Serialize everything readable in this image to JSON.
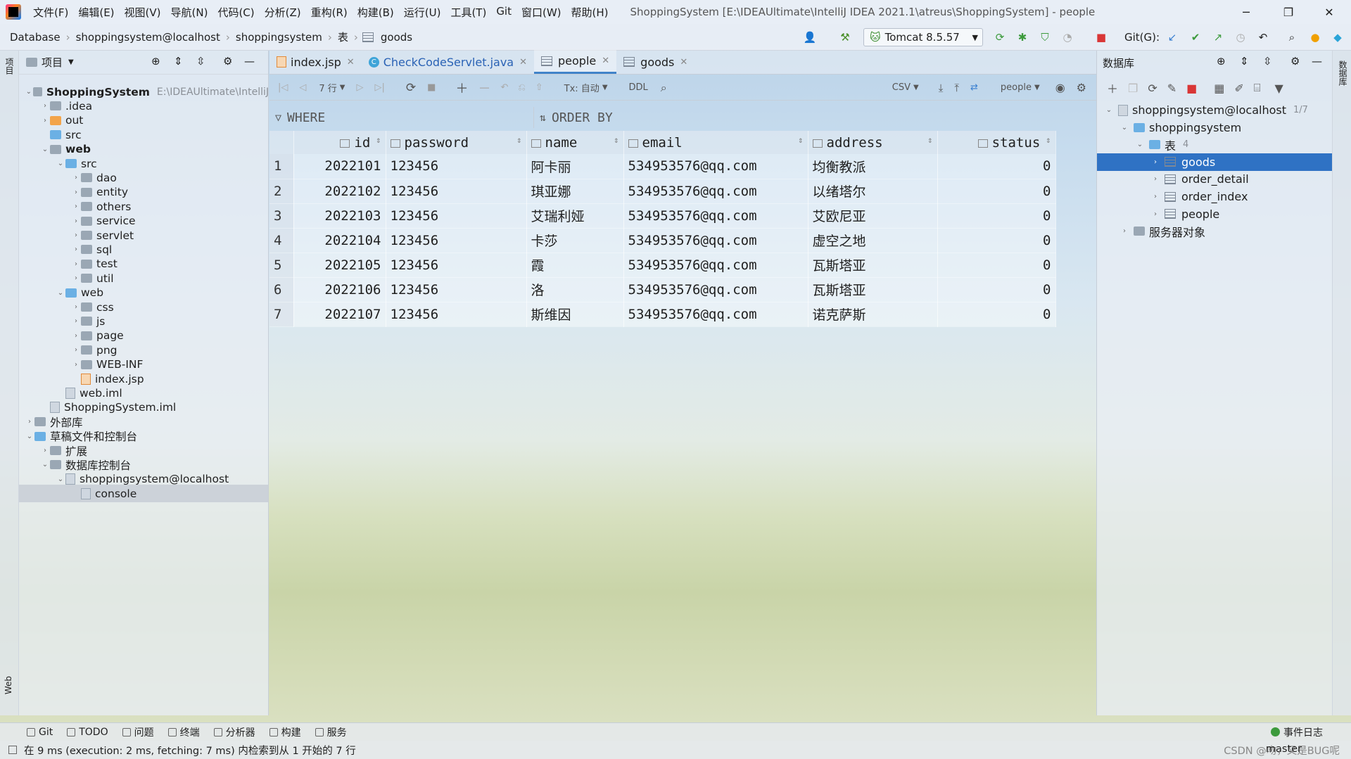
{
  "window": {
    "title": "ShoppingSystem [E:\\IDEAUltimate\\IntelliJ IDEA 2021.1\\atreus\\ShoppingSystem] - people"
  },
  "menu": [
    "文件(F)",
    "编辑(E)",
    "视图(V)",
    "导航(N)",
    "代码(C)",
    "分析(Z)",
    "重构(R)",
    "构建(B)",
    "运行(U)",
    "工具(T)",
    "Git",
    "窗口(W)",
    "帮助(H)"
  ],
  "breadcrumbs": [
    "Database",
    "shoppingsystem@localhost",
    "shoppingsystem",
    "表",
    "goods"
  ],
  "toolbar": {
    "run_config": "Tomcat 8.5.57",
    "git_label": "Git(G):"
  },
  "project": {
    "title": "项目",
    "tree": [
      {
        "label": "ShoppingSystem",
        "extra": "E:\\IDEAUltimate\\IntelliJ",
        "indent": 0,
        "arrow": "v",
        "icon": "folder",
        "bold": true
      },
      {
        "label": ".idea",
        "indent": 1,
        "arrow": ">",
        "icon": "folder"
      },
      {
        "label": "out",
        "indent": 1,
        "arrow": ">",
        "icon": "folder-orange"
      },
      {
        "label": "src",
        "indent": 1,
        "arrow": "",
        "icon": "folder-blue"
      },
      {
        "label": "web",
        "indent": 1,
        "arrow": "v",
        "icon": "folder",
        "bold": true
      },
      {
        "label": "src",
        "indent": 2,
        "arrow": "v",
        "icon": "folder-blue"
      },
      {
        "label": "dao",
        "indent": 3,
        "arrow": ">",
        "icon": "folder"
      },
      {
        "label": "entity",
        "indent": 3,
        "arrow": ">",
        "icon": "folder"
      },
      {
        "label": "others",
        "indent": 3,
        "arrow": ">",
        "icon": "folder"
      },
      {
        "label": "service",
        "indent": 3,
        "arrow": ">",
        "icon": "folder"
      },
      {
        "label": "servlet",
        "indent": 3,
        "arrow": ">",
        "icon": "folder"
      },
      {
        "label": "sql",
        "indent": 3,
        "arrow": ">",
        "icon": "folder"
      },
      {
        "label": "test",
        "indent": 3,
        "arrow": ">",
        "icon": "folder"
      },
      {
        "label": "util",
        "indent": 3,
        "arrow": ">",
        "icon": "folder"
      },
      {
        "label": "web",
        "indent": 2,
        "arrow": "v",
        "icon": "folder-blue"
      },
      {
        "label": "css",
        "indent": 3,
        "arrow": ">",
        "icon": "folder"
      },
      {
        "label": "js",
        "indent": 3,
        "arrow": ">",
        "icon": "folder"
      },
      {
        "label": "page",
        "indent": 3,
        "arrow": ">",
        "icon": "folder"
      },
      {
        "label": "png",
        "indent": 3,
        "arrow": ">",
        "icon": "folder"
      },
      {
        "label": "WEB-INF",
        "indent": 3,
        "arrow": ">",
        "icon": "folder"
      },
      {
        "label": "index.jsp",
        "indent": 3,
        "arrow": "",
        "icon": "jsp"
      },
      {
        "label": "web.iml",
        "indent": 2,
        "arrow": "",
        "icon": "file"
      },
      {
        "label": "ShoppingSystem.iml",
        "indent": 1,
        "arrow": "",
        "icon": "file"
      },
      {
        "label": "外部库",
        "indent": 0,
        "arrow": ">",
        "icon": "lib"
      },
      {
        "label": "草稿文件和控制台",
        "indent": 0,
        "arrow": "v",
        "icon": "scratch"
      },
      {
        "label": "扩展",
        "indent": 1,
        "arrow": ">",
        "icon": "folder"
      },
      {
        "label": "数据库控制台",
        "indent": 1,
        "arrow": "v",
        "icon": "folder"
      },
      {
        "label": "shoppingsystem@localhost",
        "indent": 2,
        "arrow": "v",
        "icon": "db"
      },
      {
        "label": "console",
        "indent": 3,
        "arrow": "",
        "icon": "console",
        "selected": true
      }
    ]
  },
  "tabs": [
    {
      "label": "index.jsp",
      "icon": "jsp-icon"
    },
    {
      "label": "CheckCodeServlet.java",
      "icon": "class-icon"
    },
    {
      "label": "people",
      "icon": "table-icon",
      "active": true
    },
    {
      "label": "goods",
      "icon": "table-icon"
    }
  ],
  "grid": {
    "rows_label": "7 行",
    "tx_label": "Tx: 自动",
    "ddl": "DDL",
    "csv": "CSV",
    "table_selector": "people",
    "where": "WHERE",
    "order_by": "ORDER BY",
    "columns": [
      "id",
      "password",
      "name",
      "email",
      "address",
      "status"
    ],
    "rows": [
      [
        "2022101",
        "123456",
        "阿卡丽",
        "534953576@qq.com",
        "均衡教派",
        "0"
      ],
      [
        "2022102",
        "123456",
        "琪亚娜",
        "534953576@qq.com",
        "以绪塔尔",
        "0"
      ],
      [
        "2022103",
        "123456",
        "艾瑞利娅",
        "534953576@qq.com",
        "艾欧尼亚",
        "0"
      ],
      [
        "2022104",
        "123456",
        "卡莎",
        "534953576@qq.com",
        "虚空之地",
        "0"
      ],
      [
        "2022105",
        "123456",
        "霞",
        "534953576@qq.com",
        "瓦斯塔亚",
        "0"
      ],
      [
        "2022106",
        "123456",
        "洛",
        "534953576@qq.com",
        "瓦斯塔亚",
        "0"
      ],
      [
        "2022107",
        "123456",
        "斯维因",
        "534953576@qq.com",
        "诺克萨斯",
        "0"
      ]
    ]
  },
  "database": {
    "title": "数据库",
    "tree": [
      {
        "label": "shoppingsystem@localhost",
        "extra": "1/7",
        "indent": 0,
        "arrow": "v",
        "icon": "db"
      },
      {
        "label": "shoppingsystem",
        "indent": 1,
        "arrow": "v",
        "icon": "schema"
      },
      {
        "label": "表",
        "extra": "4",
        "indent": 2,
        "arrow": "v",
        "icon": "folder"
      },
      {
        "label": "goods",
        "indent": 3,
        "arrow": ">",
        "icon": "table",
        "selected": true
      },
      {
        "label": "order_detail",
        "indent": 3,
        "arrow": ">",
        "icon": "table"
      },
      {
        "label": "order_index",
        "indent": 3,
        "arrow": ">",
        "icon": "table"
      },
      {
        "label": "people",
        "indent": 3,
        "arrow": ">",
        "icon": "table"
      },
      {
        "label": "服务器对象",
        "indent": 1,
        "arrow": ">",
        "icon": "folder"
      }
    ]
  },
  "side": {
    "left_top": "项目",
    "left_bottom": "Web",
    "right_top": "数据库"
  },
  "bottom_tools": [
    "Git",
    "TODO",
    "问题",
    "终端",
    "分析器",
    "构建",
    "服务"
  ],
  "event_log": "事件日志",
  "status": {
    "message": "在 9 ms (execution: 2 ms, fetching: 7 ms) 内检索到从 1 开始的 7 行",
    "branch": "master",
    "watermark": "CSDN @吻，又是BUG呢"
  }
}
